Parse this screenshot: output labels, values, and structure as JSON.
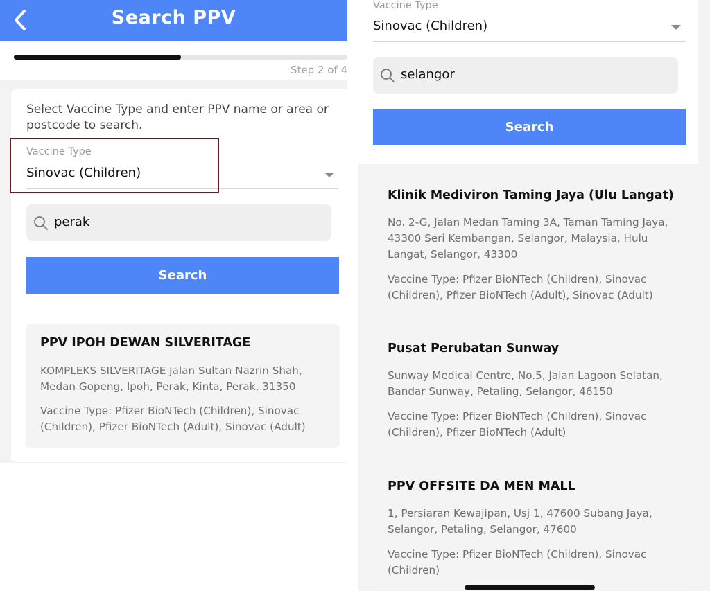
{
  "left": {
    "header_title": "Search PPV",
    "progress_fraction": 0.5,
    "step": "Step 2 of 4",
    "intro": "Select Vaccine Type and enter PPV name or area or postcode to search.",
    "vaccine_label": "Vaccine Type",
    "vaccine_value": "Sinovac (Children)",
    "search_value": "perak",
    "search_button": "Search",
    "results": [
      {
        "name": "PPV IPOH DEWAN SILVERITAGE",
        "address": "KOMPLEKS SILVERITAGE Jalan Sultan Nazrin Shah, Medan Gopeng, Ipoh, Perak, Kinta, Perak, 31350",
        "vaccines": "Vaccine Type: Pfizer BioNTech (Children), Sinovac (Children), Pfizer BioNTech (Adult), Sinovac (Adult)"
      }
    ]
  },
  "right": {
    "vaccine_label": "Vaccine Type",
    "vaccine_value": "Sinovac (Children)",
    "search_value": "selangor",
    "search_button": "Search",
    "results": [
      {
        "name": "Klinik Mediviron Taming Jaya (Ulu Langat)",
        "address": "No. 2-G, Jalan Medan Taming 3A, Taman Taming Jaya, 43300 Seri Kembangan, Selangor, Malaysia, Hulu Langat, Selangor, 43300",
        "vaccines": "Vaccine Type: Pfizer BioNTech (Children), Sinovac (Children), Pfizer BioNTech (Adult), Sinovac (Adult)"
      },
      {
        "name": "Pusat Perubatan Sunway",
        "address": "Sunway Medical Centre, No.5, Jalan Lagoon Selatan, Bandar Sunway, Petaling, Selangor, 46150",
        "vaccines": "Vaccine Type: Pfizer BioNTech (Children), Sinovac (Children), Pfizer BioNTech (Adult)"
      },
      {
        "name": "PPV OFFSITE DA MEN MALL",
        "address": "1, Persiaran Kewajipan, Usj 1, 47600 Subang Jaya, Selangor, Petaling, Selangor, 47600",
        "vaccines": "Vaccine Type: Pfizer BioNTech (Children), Sinovac (Children)"
      }
    ]
  },
  "colors": {
    "accent": "#4f86f7",
    "highlight_border": "#6b1a1f"
  },
  "icons": {
    "back": "chevron-left-icon",
    "search": "search-icon",
    "dropdown": "caret-down-icon"
  }
}
